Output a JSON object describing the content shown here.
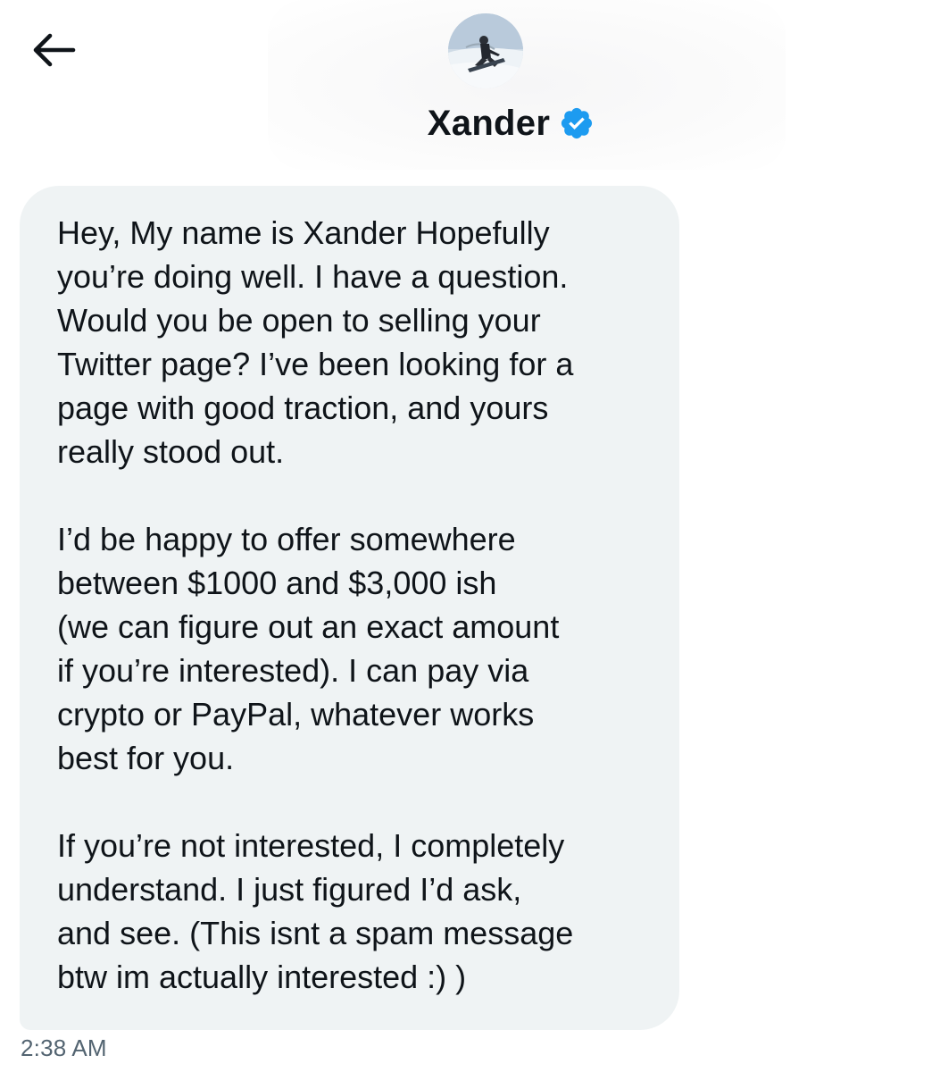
{
  "header": {
    "back_icon": "arrow-left-icon",
    "contact_name": "Xander",
    "verified_icon": "verified-badge-icon",
    "verified_color": "#1d9bf0",
    "avatar_icon": "profile-photo-snowboarder"
  },
  "message": {
    "text": "Hey, My name is Xander Hopefully\nyou’re doing well. I have a question.\nWould you be open to selling your\nTwitter page? I’ve been looking for a\npage with good traction, and yours\nreally stood out.\n\nI’d be happy to offer somewhere\nbetween $1000 and $3,000 ish\n(we can figure out an exact amount\nif you’re interested). I can pay via\ncrypto or PayPal, whatever works\nbest for you.\n\nIf you’re not interested, I completely\nunderstand. I just figured I’d ask,\nand see. (This isnt a spam message\nbtw im actually interested :) )",
    "timestamp": "2:38 AM",
    "bubble_color": "#eff3f4",
    "text_color": "#0f1419",
    "timestamp_color": "#536471"
  }
}
